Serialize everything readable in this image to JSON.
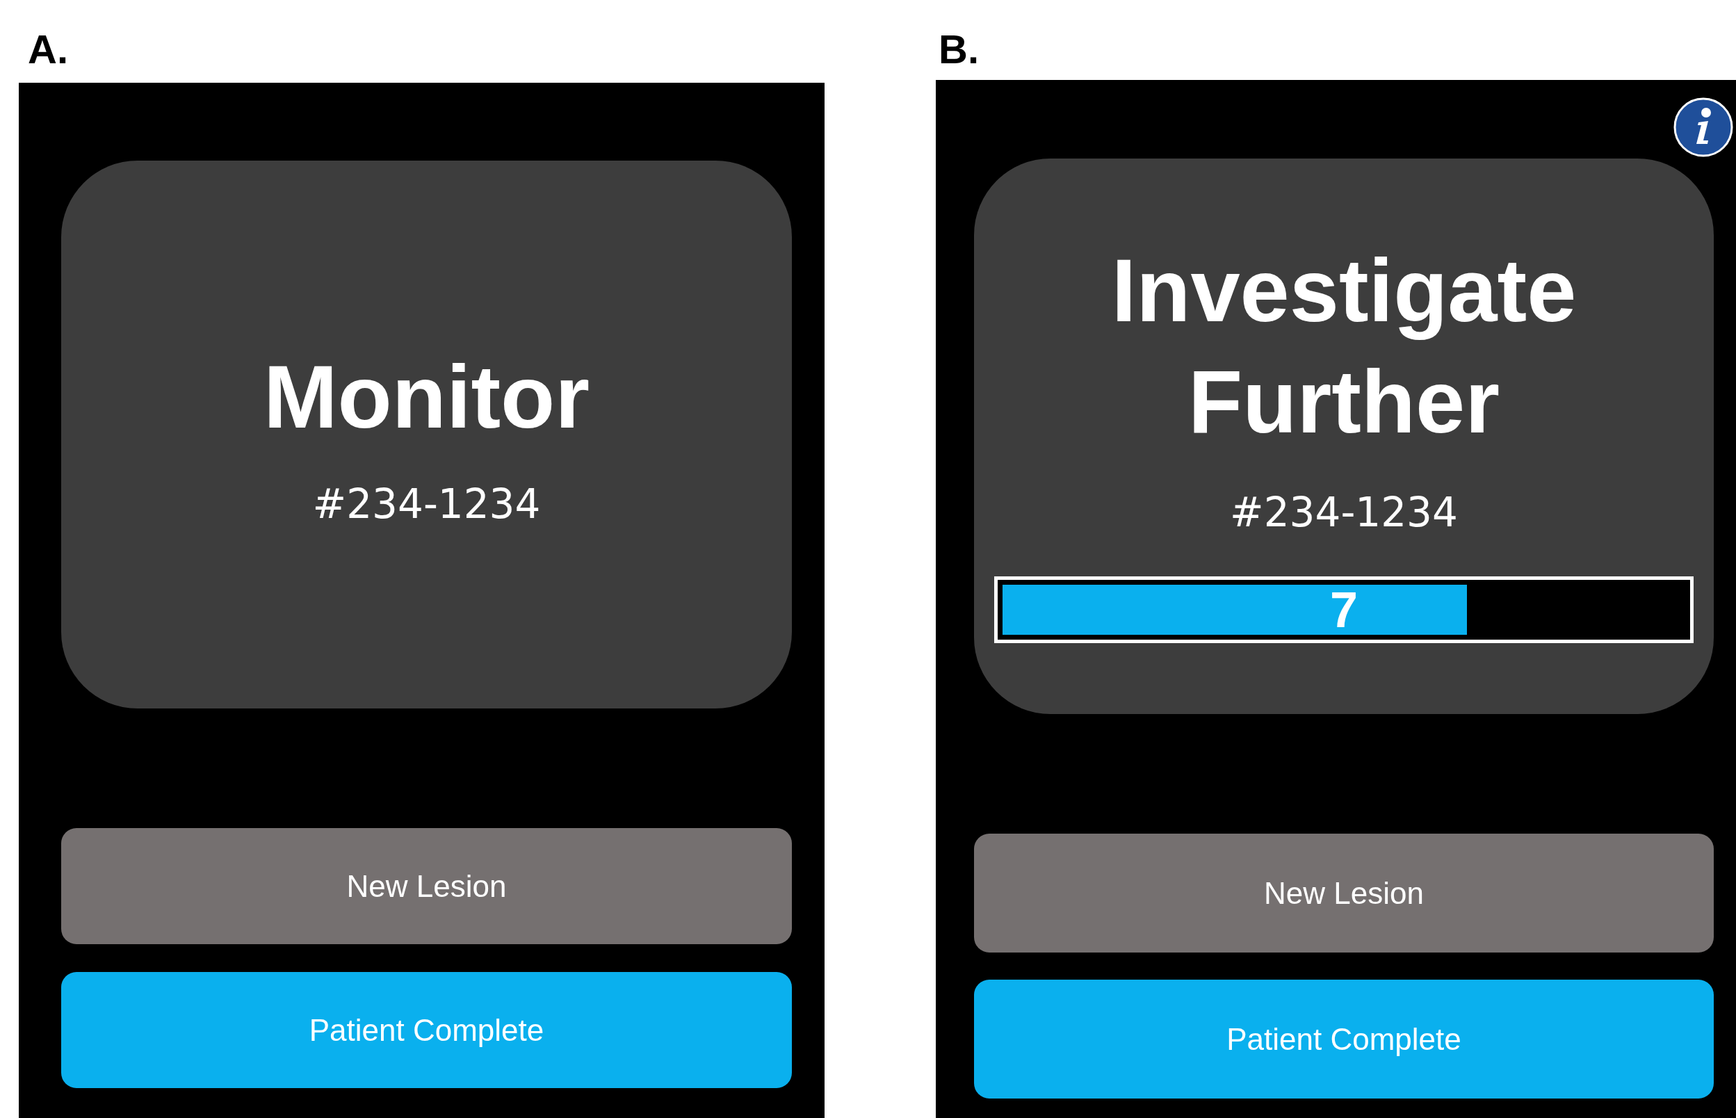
{
  "panels": [
    {
      "label": "A.",
      "info": false,
      "result": "Monitor",
      "lesion_id": "#234-1234",
      "buttons": [
        {
          "label": "New Lesion",
          "kind": "secondary"
        },
        {
          "label": "Patient Complete",
          "kind": "primary"
        }
      ]
    },
    {
      "label": "B.",
      "info": true,
      "result": "Investigate Further",
      "lesion_id": "#234-1234",
      "meter": {
        "level": 0.68,
        "reading": "7"
      },
      "buttons": [
        {
          "label": "New Lesion",
          "kind": "secondary"
        },
        {
          "label": "Patient Complete",
          "kind": "primary"
        }
      ]
    }
  ]
}
